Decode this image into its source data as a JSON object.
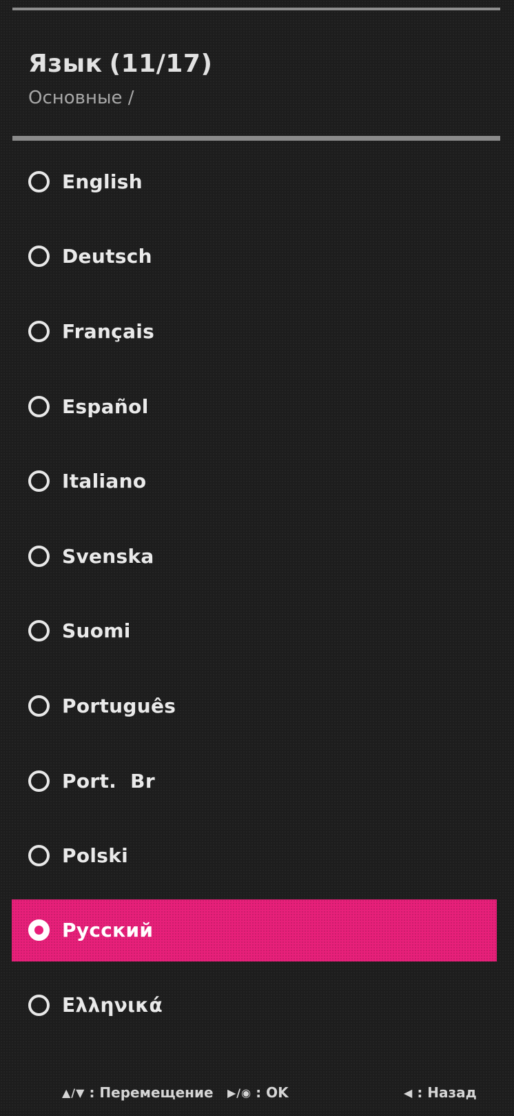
{
  "header": {
    "title": "Язык",
    "count": "(11/17)",
    "breadcrumb": "Основные /"
  },
  "languages": [
    {
      "label": "English",
      "selected": false
    },
    {
      "label": "Deutsch",
      "selected": false
    },
    {
      "label": "Français",
      "selected": false
    },
    {
      "label": "Español",
      "selected": false
    },
    {
      "label": "Italiano",
      "selected": false
    },
    {
      "label": "Svenska",
      "selected": false
    },
    {
      "label": "Suomi",
      "selected": false
    },
    {
      "label": "Português",
      "selected": false
    },
    {
      "label": "Port.  Br",
      "selected": false
    },
    {
      "label": "Polski",
      "selected": false
    },
    {
      "label": "Русский",
      "selected": true
    },
    {
      "label": "Ελληνικά",
      "selected": false
    }
  ],
  "footer": {
    "move_keys": "▲/▼",
    "move_label": ": Перемещение",
    "ok_keys": "▶/◉",
    "ok_label": ": OK",
    "back_keys": "◀",
    "back_label": ": Назад"
  },
  "colors": {
    "accent": "#e8207a",
    "background": "#1d1d1d",
    "rule": "#8b8b8b"
  }
}
